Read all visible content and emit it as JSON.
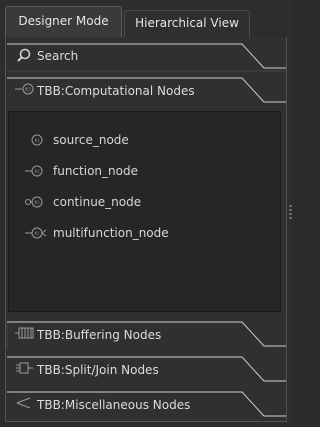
{
  "tabs": {
    "designer": "Designer Mode",
    "hierarchical": "Hierarchical View"
  },
  "sections": {
    "search": "Search",
    "computational": "TBB:Computational Nodes",
    "buffering": "TBB:Buffering Nodes",
    "splitjoin": "TBB:Split/Join Nodes",
    "misc": "TBB:Miscellaneous Nodes"
  },
  "nodes": [
    {
      "label": "source_node",
      "icon": "source-node-icon"
    },
    {
      "label": "function_node",
      "icon": "function-node-icon"
    },
    {
      "label": "continue_node",
      "icon": "continue-node-icon"
    },
    {
      "label": "multifunction_node",
      "icon": "multifunction-node-icon"
    }
  ],
  "colors": {
    "background": "#2d2d2d",
    "line": "#d0d0d0",
    "list_bg": "#262626"
  }
}
